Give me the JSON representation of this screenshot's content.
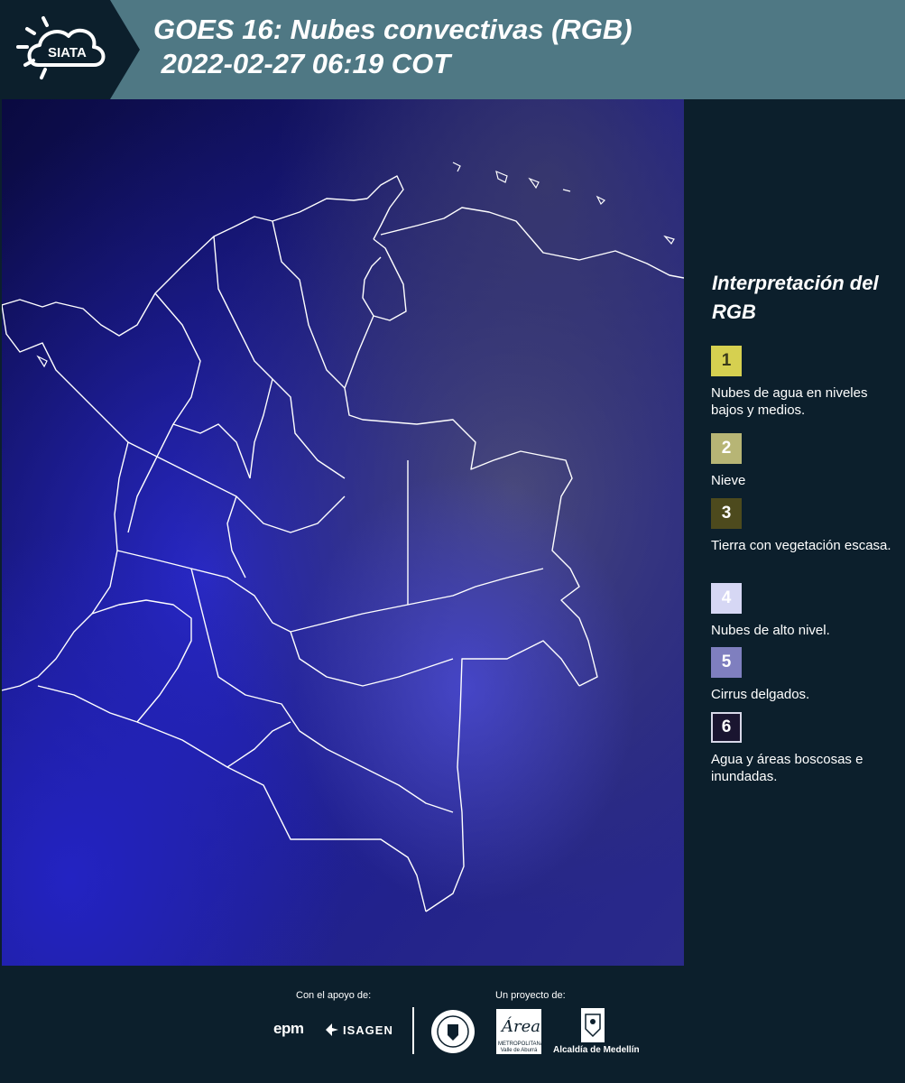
{
  "header": {
    "logo_text": "SIATA",
    "title": "GOES 16: Nubes convectivas (RGB)\n 2022-02-27 06:19 COT",
    "background_color": "#4f7884"
  },
  "legend": {
    "title": "Interpretación del RGB",
    "items": [
      {
        "number": "1",
        "label": "Nubes de agua en niveles bajos y medios.",
        "color": "#d6d050"
      },
      {
        "number": "2",
        "label": "Nieve",
        "color": "#b7b575"
      },
      {
        "number": "3",
        "label": "Tierra con vegetación escasa.",
        "color": "#4d4a1d"
      },
      {
        "number": "4",
        "label": "Nubes de alto nivel.",
        "color": "#d6d7f4"
      },
      {
        "number": "5",
        "label": "Cirrus delgados.",
        "color": "#7f7fbf"
      },
      {
        "number": "6",
        "label": "Agua y áreas boscosas e inundadas.",
        "color": "#1a1530"
      }
    ]
  },
  "footer": {
    "support_label": "Con el apoyo de:",
    "project_label": "Un proyecto de:",
    "sponsors": [
      "epm",
      "ISAGEN"
    ],
    "area_logo_text": "Área",
    "area_logo_sub": "METROPOLITANA Valle de Aburrá",
    "alcaldia_label": "Alcaldía de Medellín"
  }
}
